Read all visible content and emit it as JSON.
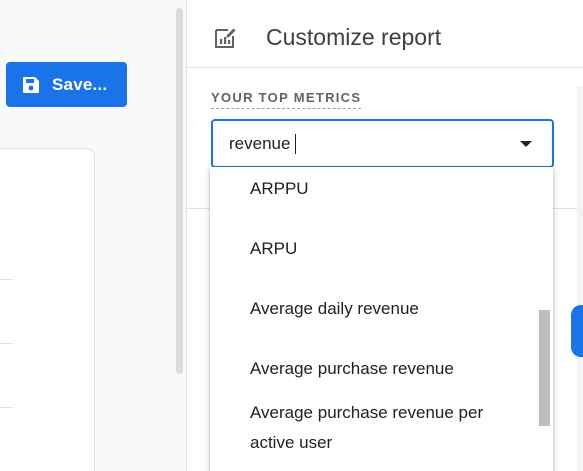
{
  "toolbar": {
    "save_label": "Save..."
  },
  "panel": {
    "title": "Customize report",
    "metrics_label": "YOUR TOP METRICS",
    "search": {
      "value": "revenue"
    },
    "options": [
      "ARPPU",
      "ARPU",
      "Average daily revenue",
      "Average purchase revenue",
      "Average purchase revenue per active user"
    ]
  },
  "colors": {
    "accent": "#1a73e8",
    "text": "#202124",
    "muted": "#5f6368"
  },
  "icons": {
    "save": "save-icon",
    "customize": "customize-report-icon",
    "dropdown": "dropdown-arrow-icon"
  }
}
